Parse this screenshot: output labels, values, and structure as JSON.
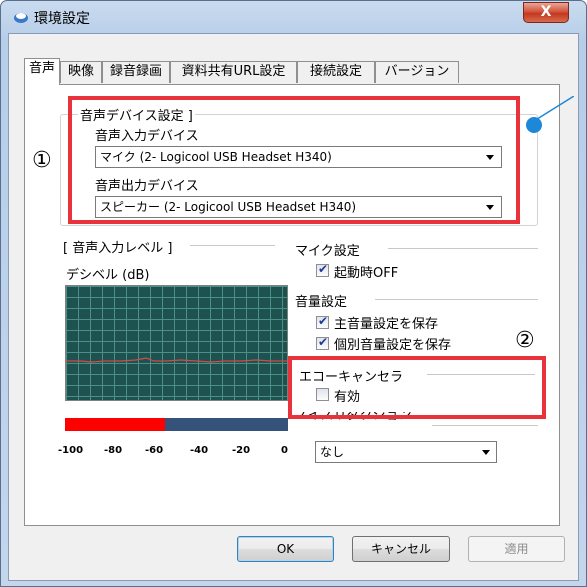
{
  "window": {
    "title": "環境設定",
    "close_label": "X"
  },
  "tabs": [
    "音声",
    "映像",
    "録音録画",
    "資料共有URL設定",
    "接続設定",
    "バージョン"
  ],
  "device_settings": {
    "group_label": "音声デバイス設定 ]",
    "input_label": "音声入力デバイス",
    "input_value": "マイク (2- Logicool USB Headset H340)",
    "output_label": "音声出力デバイス",
    "output_value": "スピーカー (2- Logicool USB Headset H340)"
  },
  "input_level": {
    "group_label": "[ 音声入力レベル ]",
    "unit_label": "デシベル (dB)",
    "ticks": [
      "-100",
      "-80",
      "-60",
      "-40",
      "-20",
      "0"
    ],
    "level_fraction": 0.45
  },
  "mic_settings": {
    "label": "マイク設定",
    "startup_off_label": "起動時OFF",
    "startup_off_checked": true
  },
  "volume_settings": {
    "label": "音量設定",
    "save_master_label": "主音量設定を保存",
    "save_master_checked": true,
    "save_individual_label": "個別音量設定を保存",
    "save_individual_checked": true
  },
  "echo_canceller": {
    "label": "エコーキャンセラ",
    "enabled_label": "有効",
    "enabled_checked": false
  },
  "noise_reduction": {
    "label": "ノイズリダクション",
    "value": "なし"
  },
  "annotations": {
    "circle1": "①",
    "circle2": "②"
  },
  "buttons": {
    "ok": "OK",
    "cancel": "キャンセル",
    "apply": "適用"
  },
  "colors": {
    "highlight": "#e8323c",
    "meter_bg": "#1d524f",
    "meter_fill": "#ff0000",
    "callout": "#1e88d8"
  }
}
